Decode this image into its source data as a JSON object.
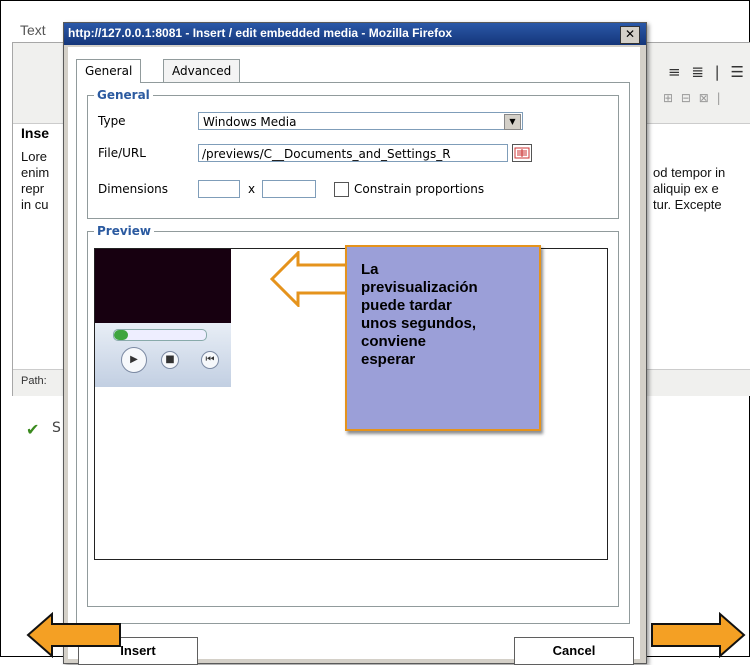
{
  "background": {
    "editor_label": "Text",
    "heading": "Inse",
    "text_left": [
      "Lore",
      "enim",
      "repr",
      "in cu"
    ],
    "text_right": [
      "od tempor in",
      "aliquip ex e",
      "tur. Excepte"
    ],
    "path_label": "Path:",
    "check_text": "S"
  },
  "dialog": {
    "title": "http://127.0.0.1:8081 - Insert / edit embedded media - Mozilla Firefox",
    "close_label": "✕",
    "tabs": [
      {
        "label": "General",
        "active": true
      },
      {
        "label": "Advanced",
        "active": false
      }
    ],
    "general_group": {
      "legend": "General",
      "type_label": "Type",
      "type_value": "Windows Media",
      "file_label": "File/URL",
      "file_value": "/previews/C__Documents_and_Settings_R",
      "dimensions_label": "Dimensions",
      "dimensions_sep": "x",
      "width_value": "",
      "height_value": "",
      "constrain_label": "Constrain proportions",
      "constrain_checked": false
    },
    "preview_group": {
      "legend": "Preview",
      "seek_progress": 0.15
    },
    "insert_label": "Insert",
    "cancel_label": "Cancel"
  },
  "callout": {
    "text": "La\nprevisualización\npuede tardar\nunos segundos,\nconviene\nesperar",
    "fill_color": "#9b9fd8",
    "border_color": "#e5931c"
  },
  "nav": {
    "prev_icon": "arrow-left-icon",
    "next_icon": "arrow-right-icon",
    "arrow_color": "#f4a024"
  }
}
